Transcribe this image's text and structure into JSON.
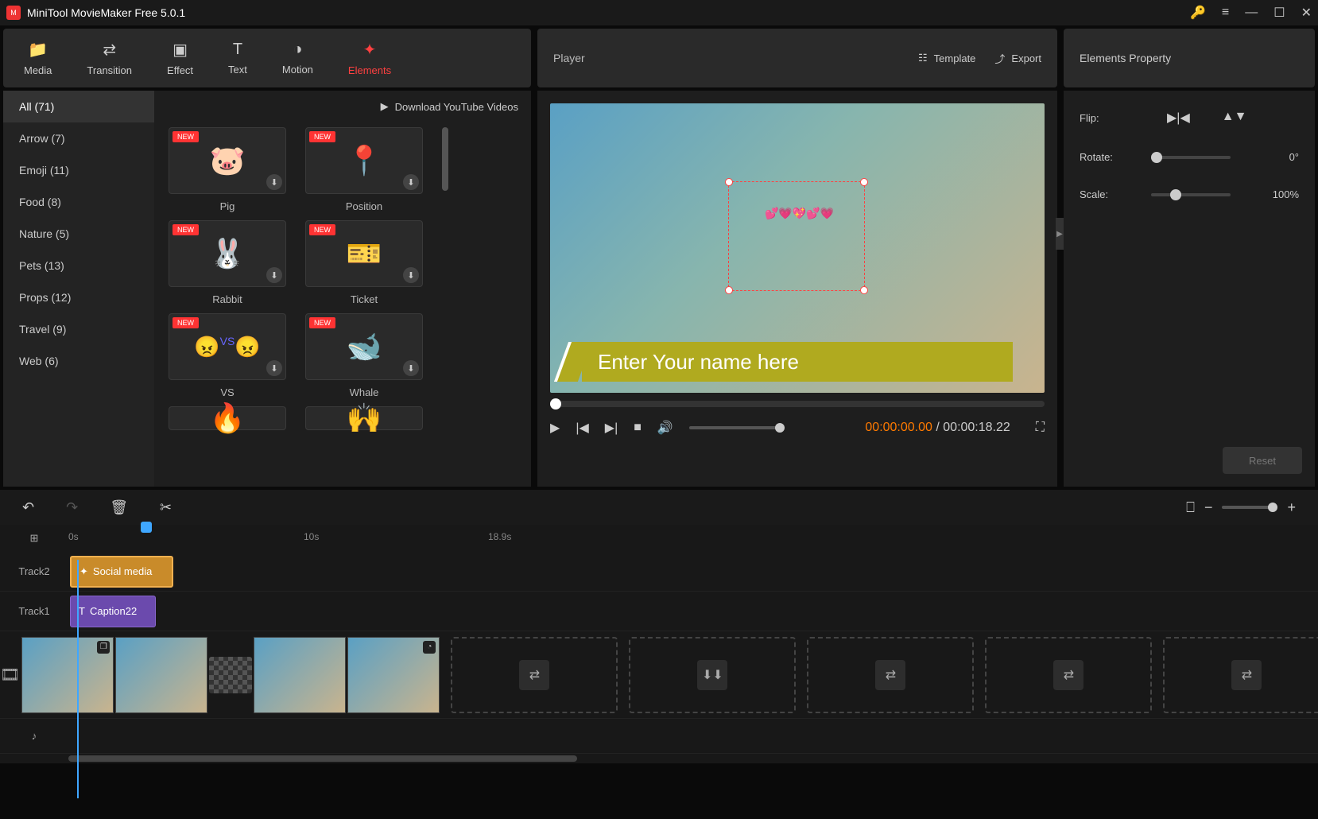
{
  "app": {
    "title": "MiniTool MovieMaker Free 5.0.1"
  },
  "tabs": {
    "media": "Media",
    "transition": "Transition",
    "effect": "Effect",
    "text": "Text",
    "motion": "Motion",
    "elements": "Elements"
  },
  "download_link": "Download YouTube Videos",
  "categories": [
    {
      "label": "All (71)",
      "active": true
    },
    {
      "label": "Arrow (7)"
    },
    {
      "label": "Emoji (11)"
    },
    {
      "label": "Food (8)"
    },
    {
      "label": "Nature (5)"
    },
    {
      "label": "Pets (13)"
    },
    {
      "label": "Props (12)"
    },
    {
      "label": "Travel (9)"
    },
    {
      "label": "Web (6)"
    }
  ],
  "elements": {
    "row1": [
      {
        "name": "Pig",
        "emoji": "🐷"
      },
      {
        "name": "Position",
        "emoji": "📍"
      }
    ],
    "row2": [
      {
        "name": "Rabbit",
        "emoji": "🐰"
      },
      {
        "name": "Ticket",
        "emoji": "🎫"
      }
    ],
    "row3": [
      {
        "name": "VS",
        "emoji": "😠😠"
      },
      {
        "name": "Whale",
        "emoji": "🐋"
      }
    ],
    "row4": [
      {
        "name": "",
        "emoji": "🔥"
      },
      {
        "name": "",
        "emoji": "🙌"
      }
    ],
    "new_label": "NEW"
  },
  "player": {
    "title": "Player",
    "template": "Template",
    "export": "Export",
    "caption_text": "Enter Your name here",
    "time_current": "00:00:00.00",
    "time_total": "00:00:18.22"
  },
  "properties": {
    "title": "Elements Property",
    "flip": "Flip:",
    "rotate": "Rotate:",
    "rotate_val": "0°",
    "scale": "Scale:",
    "scale_val": "100%",
    "reset": "Reset"
  },
  "timeline": {
    "ruler": {
      "t0": "0s",
      "t1": "10s",
      "t2": "18.9s"
    },
    "track2": "Track2",
    "track1": "Track1",
    "clip_social": "Social media",
    "clip_caption": "Caption22"
  }
}
